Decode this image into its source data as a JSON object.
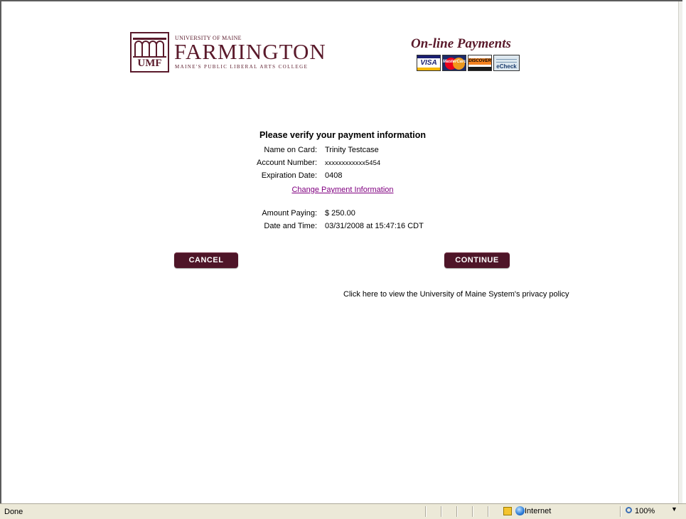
{
  "header": {
    "logo": {
      "university_line": "UNIVERSITY OF MAINE",
      "name": "FARMINGTON",
      "tagline": "MAINE'S PUBLIC LIBERAL ARTS COLLEGE",
      "badge": "UMF"
    },
    "payments_title": "On-line Payments",
    "cards": {
      "visa": "VISA",
      "mastercard": "MasterCard",
      "discover": "DISCOVER",
      "echeck": "eCheck"
    }
  },
  "verify": {
    "heading": "Please verify your payment information",
    "name_label": "Name on Card:",
    "name_value": "Trinity Testcase",
    "account_label": "Account Number:",
    "account_value": "xxxxxxxxxxxx5454",
    "expiration_label": "Expiration Date:",
    "expiration_value": "0408",
    "change_link": "Change Payment Information",
    "amount_label": "Amount Paying:",
    "amount_value": "$ 250.00",
    "datetime_label": "Date and Time:",
    "datetime_value": "03/31/2008 at 15:47:16 CDT"
  },
  "buttons": {
    "cancel": "CANCEL",
    "continue": "CONTINUE"
  },
  "privacy_text": "Click here to view the University of Maine System's privacy policy",
  "statusbar": {
    "status": "Done",
    "zone": "Internet",
    "zoom": "100%"
  },
  "colors": {
    "brand": "#5a1a2b",
    "button": "#4e1528",
    "link_visited": "#800080"
  }
}
